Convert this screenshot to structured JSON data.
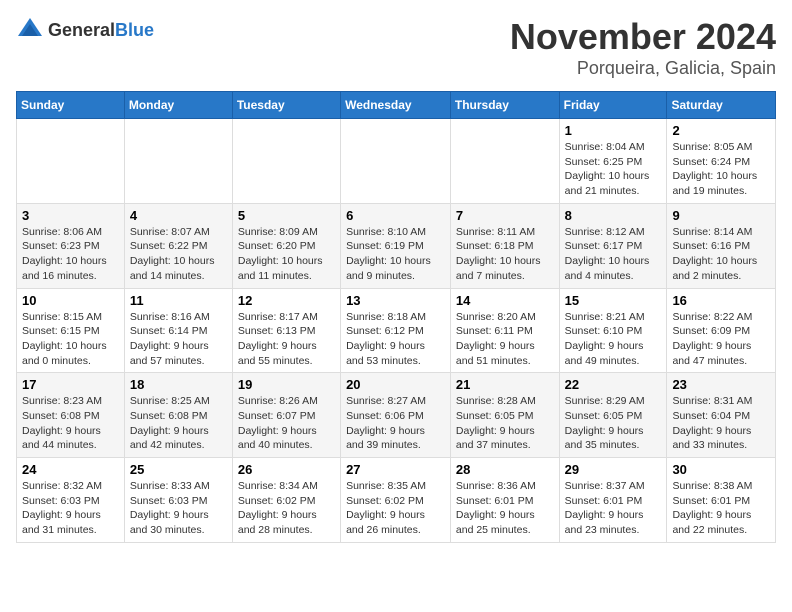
{
  "header": {
    "logo_general": "General",
    "logo_blue": "Blue",
    "month": "November 2024",
    "location": "Porqueira, Galicia, Spain"
  },
  "weekdays": [
    "Sunday",
    "Monday",
    "Tuesday",
    "Wednesday",
    "Thursday",
    "Friday",
    "Saturday"
  ],
  "weeks": [
    [
      {
        "day": "",
        "info": ""
      },
      {
        "day": "",
        "info": ""
      },
      {
        "day": "",
        "info": ""
      },
      {
        "day": "",
        "info": ""
      },
      {
        "day": "",
        "info": ""
      },
      {
        "day": "1",
        "info": "Sunrise: 8:04 AM\nSunset: 6:25 PM\nDaylight: 10 hours and 21 minutes."
      },
      {
        "day": "2",
        "info": "Sunrise: 8:05 AM\nSunset: 6:24 PM\nDaylight: 10 hours and 19 minutes."
      }
    ],
    [
      {
        "day": "3",
        "info": "Sunrise: 8:06 AM\nSunset: 6:23 PM\nDaylight: 10 hours and 16 minutes."
      },
      {
        "day": "4",
        "info": "Sunrise: 8:07 AM\nSunset: 6:22 PM\nDaylight: 10 hours and 14 minutes."
      },
      {
        "day": "5",
        "info": "Sunrise: 8:09 AM\nSunset: 6:20 PM\nDaylight: 10 hours and 11 minutes."
      },
      {
        "day": "6",
        "info": "Sunrise: 8:10 AM\nSunset: 6:19 PM\nDaylight: 10 hours and 9 minutes."
      },
      {
        "day": "7",
        "info": "Sunrise: 8:11 AM\nSunset: 6:18 PM\nDaylight: 10 hours and 7 minutes."
      },
      {
        "day": "8",
        "info": "Sunrise: 8:12 AM\nSunset: 6:17 PM\nDaylight: 10 hours and 4 minutes."
      },
      {
        "day": "9",
        "info": "Sunrise: 8:14 AM\nSunset: 6:16 PM\nDaylight: 10 hours and 2 minutes."
      }
    ],
    [
      {
        "day": "10",
        "info": "Sunrise: 8:15 AM\nSunset: 6:15 PM\nDaylight: 10 hours and 0 minutes."
      },
      {
        "day": "11",
        "info": "Sunrise: 8:16 AM\nSunset: 6:14 PM\nDaylight: 9 hours and 57 minutes."
      },
      {
        "day": "12",
        "info": "Sunrise: 8:17 AM\nSunset: 6:13 PM\nDaylight: 9 hours and 55 minutes."
      },
      {
        "day": "13",
        "info": "Sunrise: 8:18 AM\nSunset: 6:12 PM\nDaylight: 9 hours and 53 minutes."
      },
      {
        "day": "14",
        "info": "Sunrise: 8:20 AM\nSunset: 6:11 PM\nDaylight: 9 hours and 51 minutes."
      },
      {
        "day": "15",
        "info": "Sunrise: 8:21 AM\nSunset: 6:10 PM\nDaylight: 9 hours and 49 minutes."
      },
      {
        "day": "16",
        "info": "Sunrise: 8:22 AM\nSunset: 6:09 PM\nDaylight: 9 hours and 47 minutes."
      }
    ],
    [
      {
        "day": "17",
        "info": "Sunrise: 8:23 AM\nSunset: 6:08 PM\nDaylight: 9 hours and 44 minutes."
      },
      {
        "day": "18",
        "info": "Sunrise: 8:25 AM\nSunset: 6:08 PM\nDaylight: 9 hours and 42 minutes."
      },
      {
        "day": "19",
        "info": "Sunrise: 8:26 AM\nSunset: 6:07 PM\nDaylight: 9 hours and 40 minutes."
      },
      {
        "day": "20",
        "info": "Sunrise: 8:27 AM\nSunset: 6:06 PM\nDaylight: 9 hours and 39 minutes."
      },
      {
        "day": "21",
        "info": "Sunrise: 8:28 AM\nSunset: 6:05 PM\nDaylight: 9 hours and 37 minutes."
      },
      {
        "day": "22",
        "info": "Sunrise: 8:29 AM\nSunset: 6:05 PM\nDaylight: 9 hours and 35 minutes."
      },
      {
        "day": "23",
        "info": "Sunrise: 8:31 AM\nSunset: 6:04 PM\nDaylight: 9 hours and 33 minutes."
      }
    ],
    [
      {
        "day": "24",
        "info": "Sunrise: 8:32 AM\nSunset: 6:03 PM\nDaylight: 9 hours and 31 minutes."
      },
      {
        "day": "25",
        "info": "Sunrise: 8:33 AM\nSunset: 6:03 PM\nDaylight: 9 hours and 30 minutes."
      },
      {
        "day": "26",
        "info": "Sunrise: 8:34 AM\nSunset: 6:02 PM\nDaylight: 9 hours and 28 minutes."
      },
      {
        "day": "27",
        "info": "Sunrise: 8:35 AM\nSunset: 6:02 PM\nDaylight: 9 hours and 26 minutes."
      },
      {
        "day": "28",
        "info": "Sunrise: 8:36 AM\nSunset: 6:01 PM\nDaylight: 9 hours and 25 minutes."
      },
      {
        "day": "29",
        "info": "Sunrise: 8:37 AM\nSunset: 6:01 PM\nDaylight: 9 hours and 23 minutes."
      },
      {
        "day": "30",
        "info": "Sunrise: 8:38 AM\nSunset: 6:01 PM\nDaylight: 9 hours and 22 minutes."
      }
    ]
  ]
}
